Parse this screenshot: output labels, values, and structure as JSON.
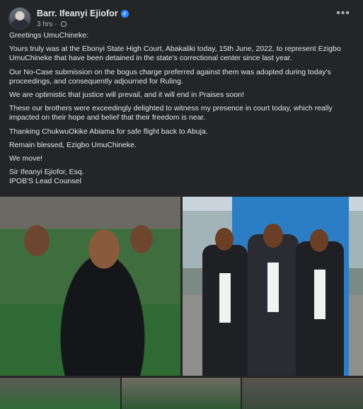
{
  "post": {
    "author": "Barr. Ifeanyi Ejiofor",
    "time": "3 hrs",
    "separator": "·",
    "more_label": "•••",
    "paragraphs": [
      "Greetings UmuChineke:",
      "Yours truly was at the Ebonyi State High Court, Abakaliki today, 15th June, 2022, to represent Ezigbo UmuChineke that have been detained in the state's correctional center since last year.",
      "Our No-Case submission on  the bogus charge preferred against them was adopted during today's proceedings,  and consequently adjourned for Ruling.",
      "We are optimistic that justice will prevail, and it will end in Praises soon!",
      "These our brothers were exceedingly delighted to witness my presence in court today, which really impacted on their hope and belief that their freedom is near.",
      "Thanking ChukwuOkike Abiama for safe flight back to Abuja.",
      "Remain blessed, Ezigbo UmuChineke.",
      "We move!"
    ],
    "signature": [
      "Sir Ifeanyi Ejiofor, Esq.",
      "IPOB'S Lead Counsel"
    ]
  },
  "colors": {
    "background": "#242526",
    "text": "#e4e6eb",
    "muted": "#b0b3b8",
    "verified": "#2d88ff"
  }
}
